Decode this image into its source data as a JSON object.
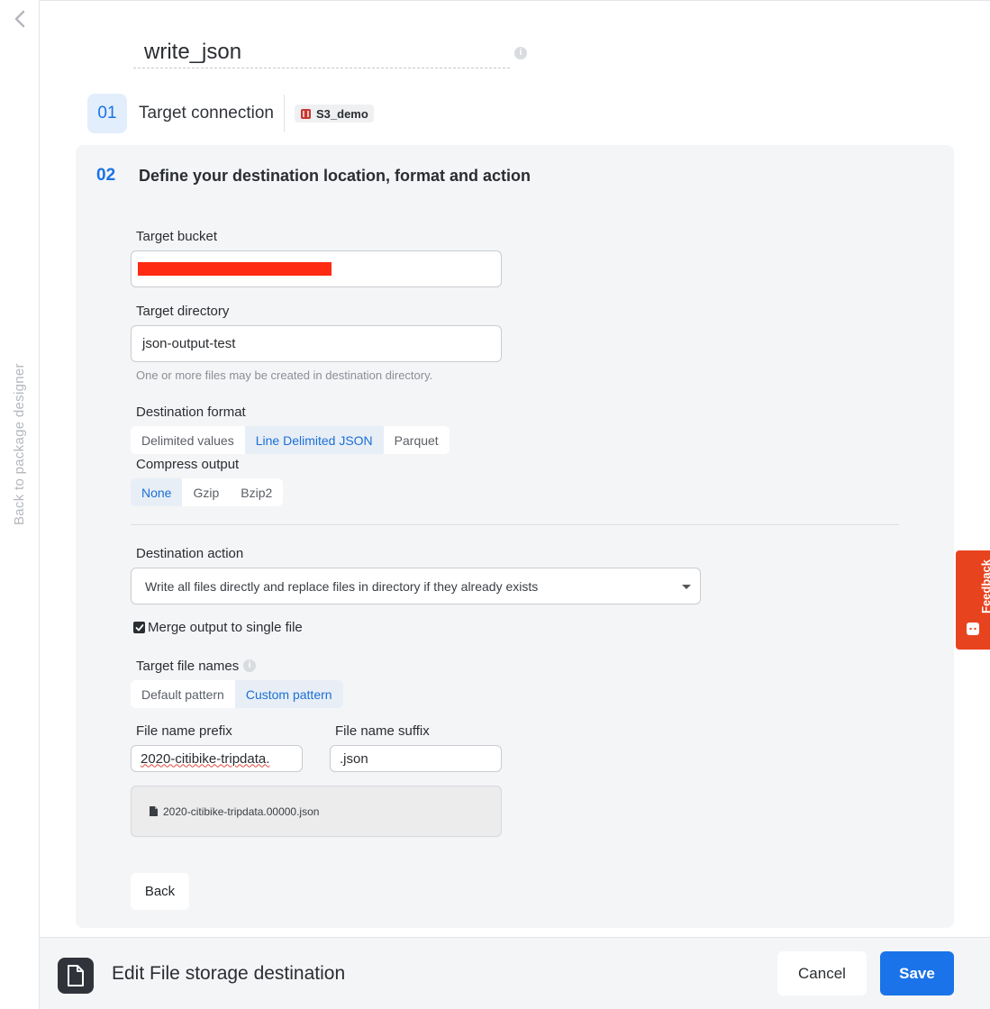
{
  "rail": {
    "back_text": "Back to package designer"
  },
  "component": {
    "name": "write_json"
  },
  "step1": {
    "number": "01",
    "label": "Target connection",
    "connection_name": "S3_demo"
  },
  "step2": {
    "number": "02",
    "title": "Define your destination location, format and action"
  },
  "target_bucket": {
    "label": "Target bucket",
    "value": ""
  },
  "target_directory": {
    "label": "Target directory",
    "value": "json-output-test",
    "hint": "One or more files may be created in destination directory."
  },
  "destination_format": {
    "label": "Destination format",
    "options": [
      "Delimited values",
      "Line Delimited JSON",
      "Parquet"
    ],
    "selected": "Line Delimited JSON"
  },
  "compress_output": {
    "label": "Compress output",
    "options": [
      "None",
      "Gzip",
      "Bzip2"
    ],
    "selected": "None"
  },
  "destination_action": {
    "label": "Destination action",
    "value": "Write all files directly and replace files in directory if they already exists"
  },
  "merge_output": {
    "label": "Merge output to single file",
    "checked": true
  },
  "target_file_names": {
    "label": "Target file names",
    "options": [
      "Default pattern",
      "Custom pattern"
    ],
    "selected": "Custom pattern"
  },
  "file_name_prefix": {
    "label": "File name prefix",
    "value": "2020-citibike-tripdata."
  },
  "file_name_suffix": {
    "label": "File name suffix",
    "value": ".json"
  },
  "preview": {
    "filename": "2020-citibike-tripdata.00000.json"
  },
  "buttons": {
    "back": "Back",
    "cancel": "Cancel",
    "save": "Save"
  },
  "footer": {
    "title": "Edit File storage destination"
  },
  "feedback": {
    "label": "Feedback"
  },
  "colors": {
    "accent": "#1a73e8",
    "feedback": "#e8431f",
    "redaction": "#ff2a12"
  }
}
